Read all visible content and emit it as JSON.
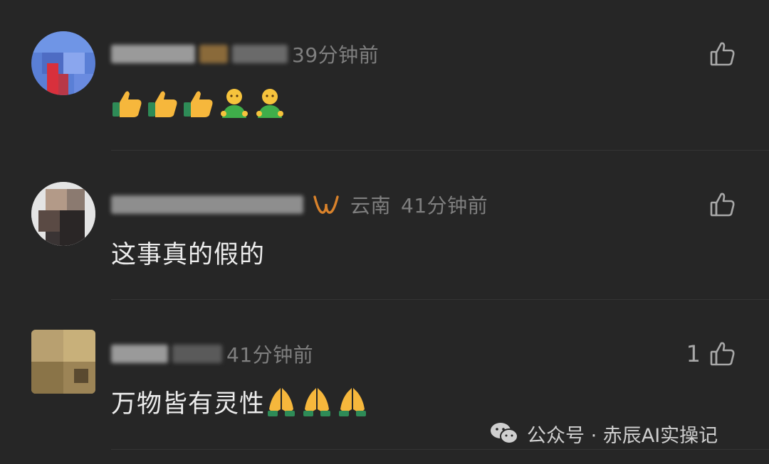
{
  "comments": [
    {
      "time": "39分钟前",
      "location": "",
      "content": "",
      "emojis": [
        "thumbs-up-emoji",
        "thumbs-up-emoji",
        "thumbs-up-emoji",
        "person-green-emoji",
        "person-green-emoji"
      ],
      "like_count": ""
    },
    {
      "time": "41分钟前",
      "location": "云南",
      "content": "这事真的假的",
      "emojis": [],
      "like_count": ""
    },
    {
      "time": "41分钟前",
      "location": "",
      "content": "万物皆有灵性",
      "emojis": [
        "folded-hands-emoji",
        "folded-hands-emoji",
        "folded-hands-emoji"
      ],
      "like_count": "1"
    }
  ],
  "watermark": {
    "text": "公众号 · 赤辰AI实操记"
  },
  "colors": {
    "background": "#262626",
    "meta_text": "#7f7f7f",
    "content_text": "#ececec",
    "badge_orange": "#d9822b",
    "divider": "#343434"
  }
}
